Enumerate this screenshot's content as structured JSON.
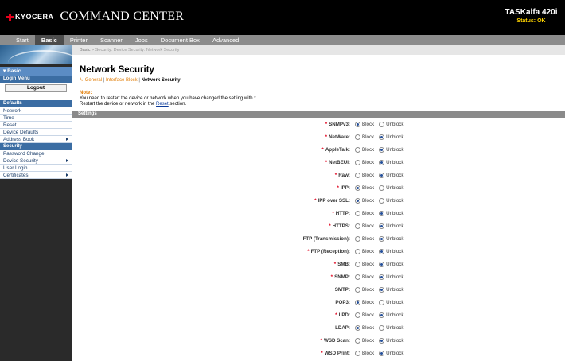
{
  "header": {
    "logo_text": "KYOCERA",
    "app_title": "COMMAND CENTER",
    "device_model": "TASKalfa 420i",
    "device_status": "Status: OK"
  },
  "tabs": [
    {
      "label": "Start",
      "active": false
    },
    {
      "label": "Basic",
      "active": true
    },
    {
      "label": "Printer",
      "active": false
    },
    {
      "label": "Scanner",
      "active": false
    },
    {
      "label": "Jobs",
      "active": false
    },
    {
      "label": "Document Box",
      "active": false
    },
    {
      "label": "Advanced",
      "active": false
    }
  ],
  "sidebar": {
    "section_basic": "▾ Basic",
    "login_menu": "Login Menu",
    "logout_label": "Logout",
    "defaults_head": "Defaults",
    "defaults_items": [
      "Network",
      "Time",
      "Reset",
      "Device Defaults",
      "Address Book"
    ],
    "security_head": "Security",
    "security_items": [
      "Password Change",
      "Device Security",
      "User Login",
      "Certificates"
    ]
  },
  "breadcrumb": {
    "root": "Basic",
    "sep": " > ",
    "path": "Security: Device Security: Network Security"
  },
  "page_title": "Network Security",
  "subnav": {
    "arrow": "↳",
    "general": "General",
    "interface_block": "Interface Block",
    "current": "Network Security",
    "sep": "|"
  },
  "note": {
    "label": "Note:",
    "line1": "You need to restart the device or network when you have changed the setting with *.",
    "line2_pre": "Restart the device or network in the ",
    "reset_link": "Reset",
    "line2_post": " section."
  },
  "settings_header": "Settings",
  "options": {
    "block": "Block",
    "unblock": "Unblock"
  },
  "settings": [
    {
      "label": "SNMPv3:",
      "required": true,
      "value": "block"
    },
    {
      "label": "NetWare:",
      "required": true,
      "value": "unblock"
    },
    {
      "label": "AppleTalk:",
      "required": true,
      "value": "unblock"
    },
    {
      "label": "NetBEUI:",
      "required": true,
      "value": "unblock"
    },
    {
      "label": "Raw:",
      "required": true,
      "value": "unblock"
    },
    {
      "label": "IPP:",
      "required": true,
      "value": "block"
    },
    {
      "label": "IPP over SSL:",
      "required": true,
      "value": "block"
    },
    {
      "label": "HTTP:",
      "required": true,
      "value": "unblock"
    },
    {
      "label": "HTTPS:",
      "required": true,
      "value": "unblock"
    },
    {
      "label": "FTP (Transmission):",
      "required": false,
      "value": "unblock"
    },
    {
      "label": "FTP (Reception):",
      "required": true,
      "value": "unblock"
    },
    {
      "label": "SMB:",
      "required": true,
      "value": "unblock"
    },
    {
      "label": "SNMP:",
      "required": true,
      "value": "unblock"
    },
    {
      "label": "SMTP:",
      "required": false,
      "value": "unblock"
    },
    {
      "label": "POP3:",
      "required": false,
      "value": "block"
    },
    {
      "label": "LPD:",
      "required": true,
      "value": "unblock"
    },
    {
      "label": "LDAP:",
      "required": false,
      "value": "block"
    },
    {
      "label": "WSD Scan:",
      "required": true,
      "value": "unblock"
    },
    {
      "label": "WSD Print:",
      "required": true,
      "value": "unblock"
    }
  ],
  "colors": {
    "header_bg": "#000000",
    "tab_bar": "#8c8c8c",
    "sidebar_blue": "#4a7ab0",
    "accent_orange": "#e07a00",
    "required_red": "#e0001b",
    "status_yellow": "#ffd400"
  }
}
